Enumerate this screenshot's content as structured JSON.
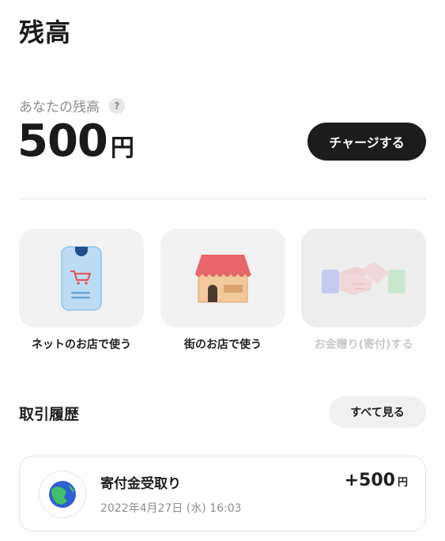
{
  "page": {
    "title": "残高"
  },
  "balance": {
    "label": "あなたの残高",
    "help_symbol": "?",
    "amount": "500",
    "unit": "円",
    "charge_label": "チャージする"
  },
  "actions": [
    {
      "label": "ネットのお店で使う",
      "icon": "smartphone-cart-icon",
      "enabled": true
    },
    {
      "label": "街のお店で使う",
      "icon": "storefront-icon",
      "enabled": true
    },
    {
      "label": "お金贈り(寄付)する",
      "icon": "handshake-icon",
      "enabled": false
    }
  ],
  "history": {
    "title": "取引履歴",
    "see_all_label": "すべて見る",
    "transactions": [
      {
        "title": "寄付金受取り",
        "date": "2022年4月27日 (水) 16:03",
        "amount": "+500",
        "unit": "円",
        "icon": "globe-logo-icon"
      }
    ]
  },
  "colors": {
    "primary_button": "#1c1c1c",
    "tile_background": "#f2f2f2",
    "muted_text": "#8c8c8c",
    "disabled_text": "#c8c8c8"
  }
}
